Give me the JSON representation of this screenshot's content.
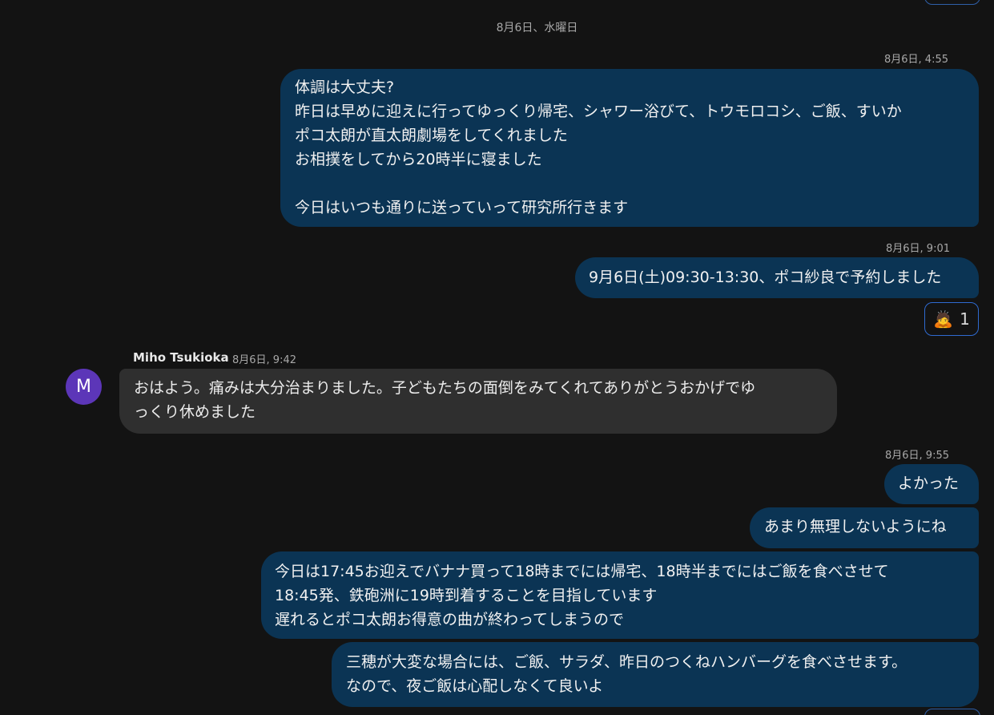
{
  "date_divider": "8月6日、水曜日",
  "messages": [
    {
      "timestamp": "8月6日, 4:55",
      "lines": [
        "体調は大丈夫?",
        "昨日は早めに迎えに行ってゆっくり帰宅、シャワー浴びて、トウモロコシ、ご飯、すいか",
        "ポコ太朗が直太朗劇場をしてくれました",
        "お相撲をしてから20時半に寝ました",
        "",
        "今日はいつも通りに送っていって研究所行きます"
      ]
    },
    {
      "timestamp": "8月6日, 9:01",
      "lines": [
        "9月6日(土)09:30-13:30、ポコ紗良で予約しました"
      ],
      "reaction": {
        "emoji": "🙇",
        "count": "1"
      }
    },
    {
      "sender": "Miho Tsukioka",
      "avatar_letter": "M",
      "timestamp": "8月6日, 9:42",
      "lines": [
        "おはよう。痛みは大分治まりました。子どもたちの面倒をみてくれてありがとうおかげでゆ",
        "っくり休めました"
      ]
    },
    {
      "timestamp": "8月6日, 9:55",
      "lines": [
        "よかった"
      ]
    },
    {
      "lines": [
        "あまり無理しないようにね"
      ]
    },
    {
      "lines": [
        "今日は17:45お迎えでバナナ買って18時までには帰宅、18時半までにはご飯を食べさせて",
        "18:45発、鉄砲洲に19時到着することを目指しています",
        "遅れるとポコ太朗お得意の曲が終わってしまうので"
      ]
    },
    {
      "lines": [
        "三穂が大変な場合には、ご飯、サラダ、昨日のつくねハンバーグを食べさせます。",
        "なので、夜ご飯は心配しなくて良いよ"
      ]
    }
  ],
  "colors": {
    "background": "#131313",
    "outgoing_bubble": "#0b3454",
    "incoming_bubble": "#2f2f2f",
    "avatar": "#5c36b8",
    "reaction_border": "#2f6ad0"
  }
}
